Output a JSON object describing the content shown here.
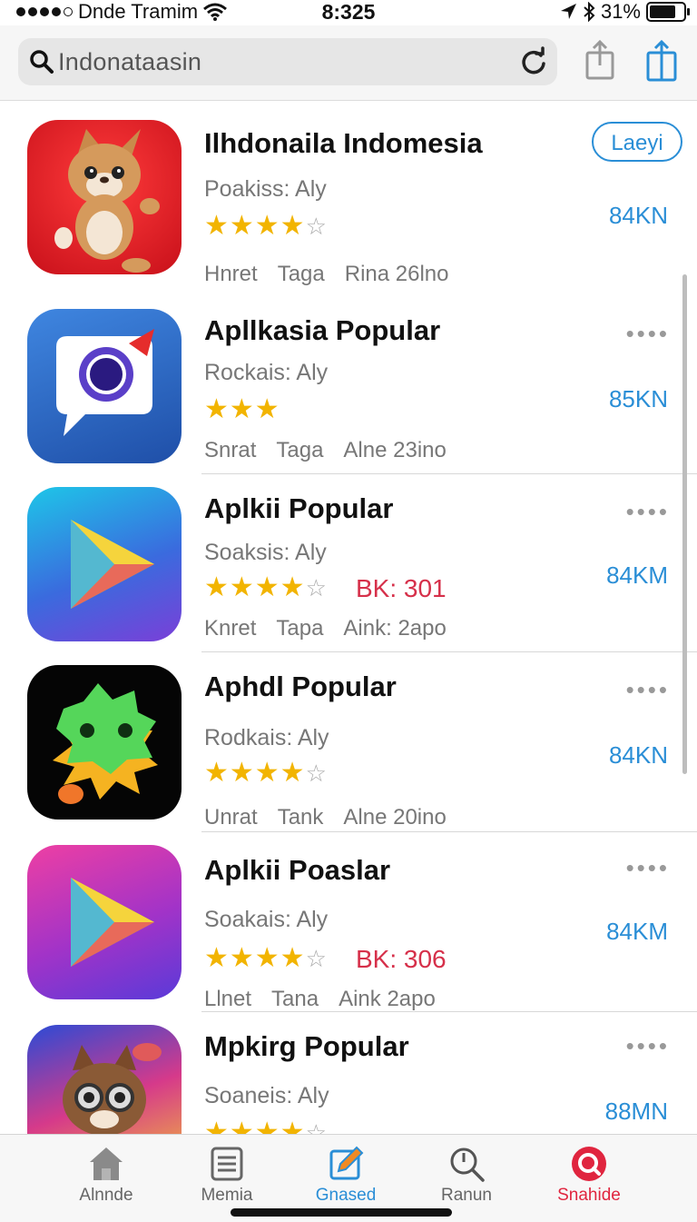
{
  "status_bar": {
    "carrier": "Dnde Tramim",
    "time": "8:325",
    "battery": "31%"
  },
  "search": {
    "query": "Indonataasin"
  },
  "apps": [
    {
      "title": "Ilhdonaila Indomesia",
      "subtitle": "Poakiss: Aly",
      "stars": 4,
      "badge": "",
      "meta": [
        "Hnret",
        "Taga",
        "Rina 26lno"
      ],
      "size": "84KN",
      "action": "Laeyi"
    },
    {
      "title": "Apllkasia Popular",
      "subtitle": "Rockais: Aly",
      "stars": 3,
      "badge": "",
      "meta": [
        "Snrat",
        "Taga",
        "Alne 23ino"
      ],
      "size": "85KN",
      "action": "••••"
    },
    {
      "title": "Aplkii Popular",
      "subtitle": "Soaksis: Aly",
      "stars": 4,
      "badge": "BK: 301",
      "meta": [
        "Knret",
        "Tapa",
        "Aink: 2apo"
      ],
      "size": "84KM",
      "action": "••••"
    },
    {
      "title": "Aphdl Popular",
      "subtitle": "Rodkais: Aly",
      "stars": 4,
      "badge": "",
      "meta": [
        "Unrat",
        "Tank",
        "Alne 20ino"
      ],
      "size": "84KN",
      "action": "••••"
    },
    {
      "title": "Aplkii Poaslar",
      "subtitle": "Soakais: Aly",
      "stars": 4,
      "badge": "BK: 306",
      "meta": [
        "Llnet",
        "Tana",
        "Aink 2apo"
      ],
      "size": "84KM",
      "action": "••••"
    },
    {
      "title": "Mpkirg Popular",
      "subtitle": "Soaneis: Aly",
      "stars": 4,
      "badge": "",
      "meta": [],
      "size": "88MN",
      "action": "••••"
    }
  ],
  "tabs": [
    {
      "label": "Alnnde",
      "icon": "home-icon"
    },
    {
      "label": "Memia",
      "icon": "list-icon"
    },
    {
      "label": "Gnased",
      "icon": "edit-icon"
    },
    {
      "label": "Ranun",
      "icon": "search-icon"
    },
    {
      "label": "Snahide",
      "icon": "brand-icon"
    }
  ],
  "colors": {
    "accent": "#2a8ed6",
    "star": "#f2b400",
    "badge": "#d6304a",
    "brand": "#e0253f"
  }
}
